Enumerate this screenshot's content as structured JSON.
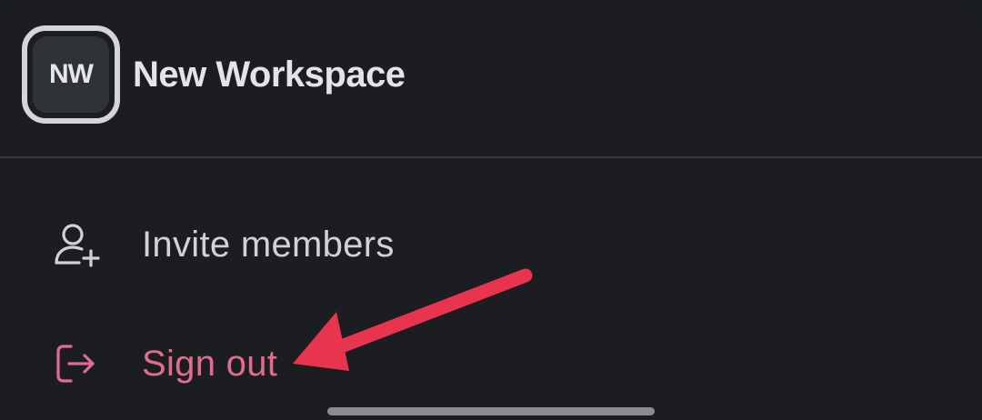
{
  "workspace": {
    "initials": "NW",
    "name": "New Workspace"
  },
  "menu": {
    "invite_label": "Invite members",
    "signout_label": "Sign out"
  },
  "icons": {
    "invite": "add-user-icon",
    "signout": "sign-out-icon"
  },
  "colors": {
    "background": "#1b1d21",
    "text": "#d1d2d3",
    "danger": "#e06c8f",
    "annotation_arrow": "#e8344e"
  }
}
